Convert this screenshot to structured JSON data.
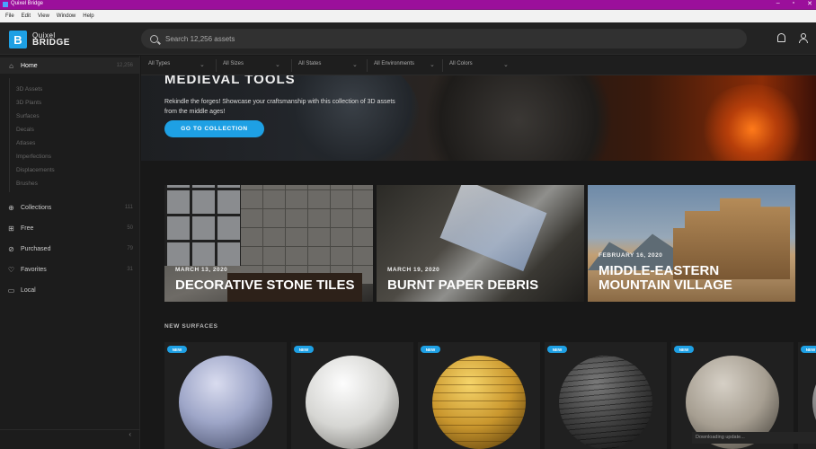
{
  "window": {
    "title": "Quixel Bridge",
    "controls": [
      "–",
      "▫",
      "✕"
    ]
  },
  "menu": [
    "File",
    "Edit",
    "View",
    "Window",
    "Help"
  ],
  "logo": {
    "line1": "Quixel",
    "line2": "BRIDGE",
    "mark": "B"
  },
  "search": {
    "placeholder": "Search 12,256 assets",
    "value": ""
  },
  "sidebar": {
    "home": {
      "label": "Home",
      "count": "12,256"
    },
    "sub": [
      "3D Assets",
      "3D Plants",
      "Surfaces",
      "Decals",
      "Atlases",
      "Imperfections",
      "Displacements",
      "Brushes"
    ],
    "items": [
      {
        "label": "Collections",
        "count": "111",
        "icon": "collections-icon"
      },
      {
        "label": "Free",
        "count": "50",
        "icon": "gift-icon"
      },
      {
        "label": "Purchased",
        "count": "79",
        "icon": "check-circle-icon"
      },
      {
        "label": "Favorites",
        "count": "31",
        "icon": "heart-icon"
      },
      {
        "label": "Local",
        "count": "",
        "icon": "monitor-icon"
      }
    ],
    "collapse": "‹"
  },
  "filters": [
    "All Types",
    "All Sizes",
    "All States",
    "All Environments",
    "All Colors"
  ],
  "hero": {
    "title": "MEDIEVAL TOOLS",
    "description": "Rekindle the forges! Showcase your craftsmanship with this collection of 3D assets from the middle ages!",
    "cta": "GO TO COLLECTION"
  },
  "featured": [
    {
      "date": "MARCH 13, 2020",
      "name": "DECORATIVE STONE TILES"
    },
    {
      "date": "MARCH 19, 2020",
      "name": "BURNT PAPER DEBRIS"
    },
    {
      "date": "FEBRUARY 16, 2020",
      "name": "MIDDLE-EASTERN MOUNTAIN VILLAGE"
    }
  ],
  "new_surfaces": {
    "heading": "NEW SURFACES",
    "badge": "NEW"
  },
  "toast": "Downloading update..."
}
